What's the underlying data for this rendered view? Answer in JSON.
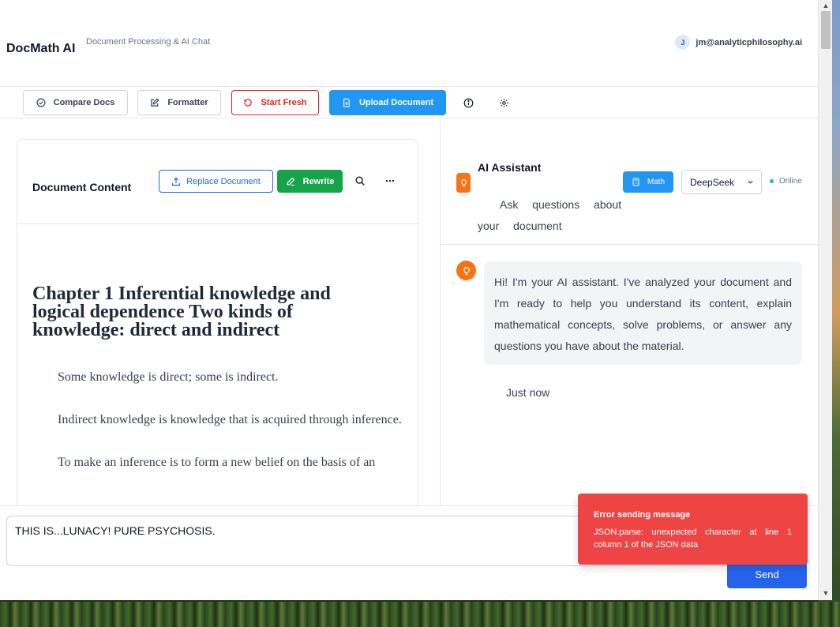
{
  "app": {
    "name": "DocMath AI",
    "tagline": "Document Processing & AI Chat",
    "user_initial": "J",
    "user_email": "jm@analyticphilosophy.ai"
  },
  "toolbar": {
    "compare_label": "Compare Docs",
    "formatter_label": "Formatter",
    "fresh_label": "Start Fresh",
    "upload_label": "Upload Document"
  },
  "document": {
    "panel_title": "Document Content",
    "replace_label": "Replace Document",
    "rewrite_label": "Rewrite",
    "chapter_title": "Chapter 1 Inferential knowledge and logical dependence Two kinds of knowledge: direct and indirect",
    "paragraphs": [
      "Some knowledge is direct; some is indirect.",
      "Indirect knowledge is knowledge that is acquired through inference.",
      "To make an inference is to form a new belief on the basis of an"
    ]
  },
  "assistant": {
    "title": "AI Assistant",
    "subtitle": "Ask questions about your document",
    "math_label": "Math",
    "model": "DeepSeek",
    "status": "Online",
    "message": "Hi! I'm your AI assistant. I've analyzed your document and I'm ready to help you understand its content, explain mathematical concepts, solve problems, or answer any questions you have about the material.",
    "message_time": "Just now"
  },
  "composer": {
    "input_value": "THIS IS...LUNACY! PURE PSYCHOSIS.",
    "send_label": "Send"
  },
  "toast": {
    "title": "Error sending message",
    "message": "JSON.parse: unexpected character at line 1 column 1 of the JSON data"
  },
  "colors": {
    "primary": "#2196f3",
    "danger": "#dc2626",
    "success": "#16a34a",
    "accent": "#f97316",
    "toast": "#ef4444"
  },
  "icons": [
    "compare-icon",
    "edit-icon",
    "refresh-icon",
    "file-icon",
    "info-icon",
    "gear-icon",
    "upload-icon",
    "pencil-icon",
    "search-icon",
    "more-icon",
    "lightbulb-icon",
    "calculator-icon",
    "chevron-down-icon"
  ]
}
